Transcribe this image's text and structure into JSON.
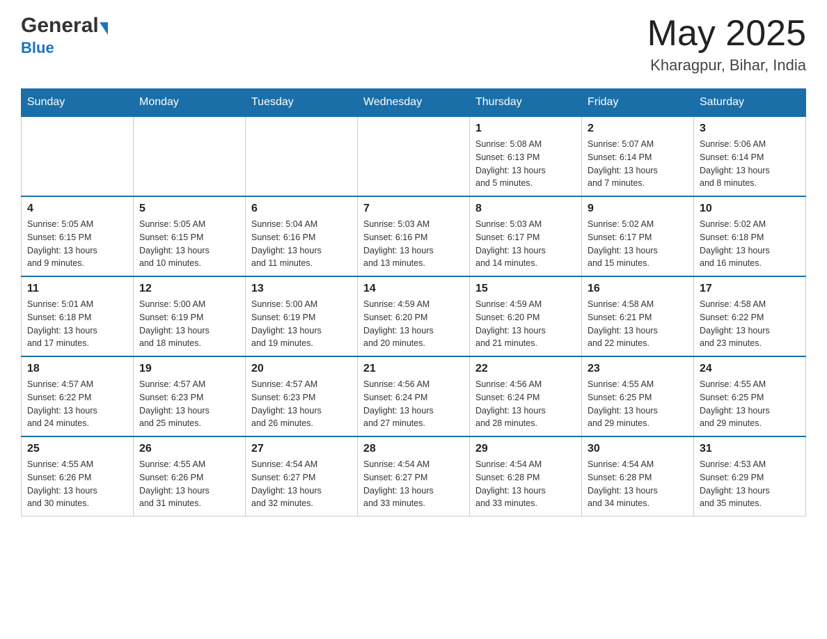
{
  "header": {
    "logo_general": "General",
    "logo_blue": "Blue",
    "month_year": "May 2025",
    "location": "Kharagpur, Bihar, India"
  },
  "days_of_week": [
    "Sunday",
    "Monday",
    "Tuesday",
    "Wednesday",
    "Thursday",
    "Friday",
    "Saturday"
  ],
  "weeks": [
    {
      "days": [
        {
          "number": "",
          "info": ""
        },
        {
          "number": "",
          "info": ""
        },
        {
          "number": "",
          "info": ""
        },
        {
          "number": "",
          "info": ""
        },
        {
          "number": "1",
          "info": "Sunrise: 5:08 AM\nSunset: 6:13 PM\nDaylight: 13 hours\nand 5 minutes."
        },
        {
          "number": "2",
          "info": "Sunrise: 5:07 AM\nSunset: 6:14 PM\nDaylight: 13 hours\nand 7 minutes."
        },
        {
          "number": "3",
          "info": "Sunrise: 5:06 AM\nSunset: 6:14 PM\nDaylight: 13 hours\nand 8 minutes."
        }
      ]
    },
    {
      "days": [
        {
          "number": "4",
          "info": "Sunrise: 5:05 AM\nSunset: 6:15 PM\nDaylight: 13 hours\nand 9 minutes."
        },
        {
          "number": "5",
          "info": "Sunrise: 5:05 AM\nSunset: 6:15 PM\nDaylight: 13 hours\nand 10 minutes."
        },
        {
          "number": "6",
          "info": "Sunrise: 5:04 AM\nSunset: 6:16 PM\nDaylight: 13 hours\nand 11 minutes."
        },
        {
          "number": "7",
          "info": "Sunrise: 5:03 AM\nSunset: 6:16 PM\nDaylight: 13 hours\nand 13 minutes."
        },
        {
          "number": "8",
          "info": "Sunrise: 5:03 AM\nSunset: 6:17 PM\nDaylight: 13 hours\nand 14 minutes."
        },
        {
          "number": "9",
          "info": "Sunrise: 5:02 AM\nSunset: 6:17 PM\nDaylight: 13 hours\nand 15 minutes."
        },
        {
          "number": "10",
          "info": "Sunrise: 5:02 AM\nSunset: 6:18 PM\nDaylight: 13 hours\nand 16 minutes."
        }
      ]
    },
    {
      "days": [
        {
          "number": "11",
          "info": "Sunrise: 5:01 AM\nSunset: 6:18 PM\nDaylight: 13 hours\nand 17 minutes."
        },
        {
          "number": "12",
          "info": "Sunrise: 5:00 AM\nSunset: 6:19 PM\nDaylight: 13 hours\nand 18 minutes."
        },
        {
          "number": "13",
          "info": "Sunrise: 5:00 AM\nSunset: 6:19 PM\nDaylight: 13 hours\nand 19 minutes."
        },
        {
          "number": "14",
          "info": "Sunrise: 4:59 AM\nSunset: 6:20 PM\nDaylight: 13 hours\nand 20 minutes."
        },
        {
          "number": "15",
          "info": "Sunrise: 4:59 AM\nSunset: 6:20 PM\nDaylight: 13 hours\nand 21 minutes."
        },
        {
          "number": "16",
          "info": "Sunrise: 4:58 AM\nSunset: 6:21 PM\nDaylight: 13 hours\nand 22 minutes."
        },
        {
          "number": "17",
          "info": "Sunrise: 4:58 AM\nSunset: 6:22 PM\nDaylight: 13 hours\nand 23 minutes."
        }
      ]
    },
    {
      "days": [
        {
          "number": "18",
          "info": "Sunrise: 4:57 AM\nSunset: 6:22 PM\nDaylight: 13 hours\nand 24 minutes."
        },
        {
          "number": "19",
          "info": "Sunrise: 4:57 AM\nSunset: 6:23 PM\nDaylight: 13 hours\nand 25 minutes."
        },
        {
          "number": "20",
          "info": "Sunrise: 4:57 AM\nSunset: 6:23 PM\nDaylight: 13 hours\nand 26 minutes."
        },
        {
          "number": "21",
          "info": "Sunrise: 4:56 AM\nSunset: 6:24 PM\nDaylight: 13 hours\nand 27 minutes."
        },
        {
          "number": "22",
          "info": "Sunrise: 4:56 AM\nSunset: 6:24 PM\nDaylight: 13 hours\nand 28 minutes."
        },
        {
          "number": "23",
          "info": "Sunrise: 4:55 AM\nSunset: 6:25 PM\nDaylight: 13 hours\nand 29 minutes."
        },
        {
          "number": "24",
          "info": "Sunrise: 4:55 AM\nSunset: 6:25 PM\nDaylight: 13 hours\nand 29 minutes."
        }
      ]
    },
    {
      "days": [
        {
          "number": "25",
          "info": "Sunrise: 4:55 AM\nSunset: 6:26 PM\nDaylight: 13 hours\nand 30 minutes."
        },
        {
          "number": "26",
          "info": "Sunrise: 4:55 AM\nSunset: 6:26 PM\nDaylight: 13 hours\nand 31 minutes."
        },
        {
          "number": "27",
          "info": "Sunrise: 4:54 AM\nSunset: 6:27 PM\nDaylight: 13 hours\nand 32 minutes."
        },
        {
          "number": "28",
          "info": "Sunrise: 4:54 AM\nSunset: 6:27 PM\nDaylight: 13 hours\nand 33 minutes."
        },
        {
          "number": "29",
          "info": "Sunrise: 4:54 AM\nSunset: 6:28 PM\nDaylight: 13 hours\nand 33 minutes."
        },
        {
          "number": "30",
          "info": "Sunrise: 4:54 AM\nSunset: 6:28 PM\nDaylight: 13 hours\nand 34 minutes."
        },
        {
          "number": "31",
          "info": "Sunrise: 4:53 AM\nSunset: 6:29 PM\nDaylight: 13 hours\nand 35 minutes."
        }
      ]
    }
  ]
}
